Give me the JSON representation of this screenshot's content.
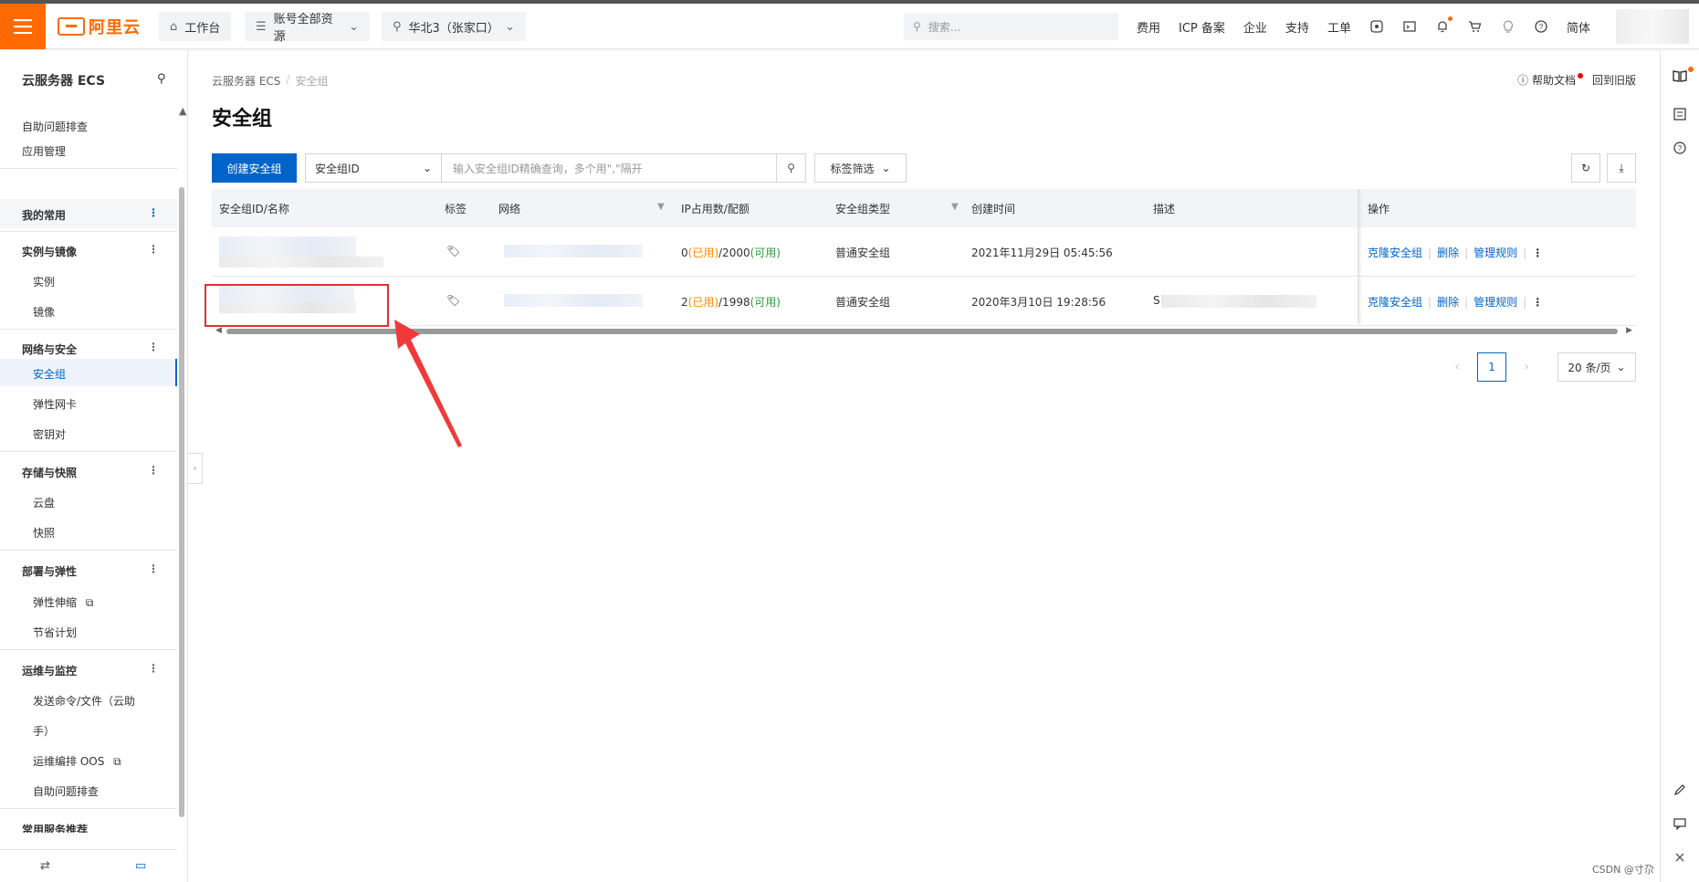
{
  "topbar": {
    "logo_text": "阿里云",
    "workbench": "工作台",
    "resources": "账号全部资源",
    "region": "华北3（张家口）",
    "search_placeholder": "搜索...",
    "nav": [
      "费用",
      "ICP 备案",
      "企业",
      "支持",
      "工单"
    ],
    "lang": "简体"
  },
  "sidebar": {
    "title": "云服务器 ECS",
    "top_items": [
      "自助问题排查",
      "应用管理"
    ],
    "favorites": "我的常用",
    "groups": {
      "instances": {
        "label": "实例与镜像",
        "items": [
          "实例",
          "镜像"
        ]
      },
      "network": {
        "label": "网络与安全",
        "items": [
          "安全组",
          "弹性网卡",
          "密钥对"
        ]
      },
      "storage": {
        "label": "存储与快照",
        "items": [
          "云盘",
          "快照"
        ]
      },
      "deploy": {
        "label": "部署与弹性",
        "items": [
          "弹性伸缩",
          "节省计划"
        ]
      },
      "ops": {
        "label": "运维与监控",
        "items": [
          "发送命令/文件（云助",
          "手）",
          "运维编排 OOS",
          "自助问题排查"
        ]
      }
    },
    "more_group": "常用服务推荐"
  },
  "breadcrumb": {
    "root": "云服务器 ECS",
    "current": "安全组"
  },
  "help": {
    "docs": "帮助文档",
    "old": "回到旧版"
  },
  "page_title": "安全组",
  "toolbar": {
    "create_label": "创建安全组",
    "select_value": "安全组ID",
    "search_placeholder": "输入安全组ID精确查询，多个用\",\"隔开",
    "tag_filter": "标签筛选"
  },
  "table": {
    "headers": [
      "安全组ID/名称",
      "标签",
      "网络",
      "IP占用数/配额",
      "安全组类型",
      "创建时间",
      "描述",
      "操作"
    ],
    "rows": [
      {
        "used": "0",
        "used_label": "(已用)",
        "quota": "/2000",
        "avail_label": "(可用)",
        "type": "普通安全组",
        "created": "2021年11月29日 05:45:56",
        "desc_prefix": ""
      },
      {
        "used": "2",
        "used_label": "(已用)",
        "quota": "/1998",
        "avail_label": "(可用)",
        "type": "普通安全组",
        "created": "2020年3月10日 19:28:56",
        "desc_prefix": "S"
      }
    ],
    "actions": {
      "clone": "克隆安全组",
      "delete": "删除",
      "manage": "管理规则"
    }
  },
  "pager": {
    "current": "1",
    "page_size": "20 条/页"
  },
  "watermark": "CSDN @寸尕",
  "colors": {
    "brand": "#ff6a00",
    "primary": "#0064c8",
    "used": "#ff8a00",
    "available": "#2e9e3e",
    "annotation": "#e03030"
  }
}
